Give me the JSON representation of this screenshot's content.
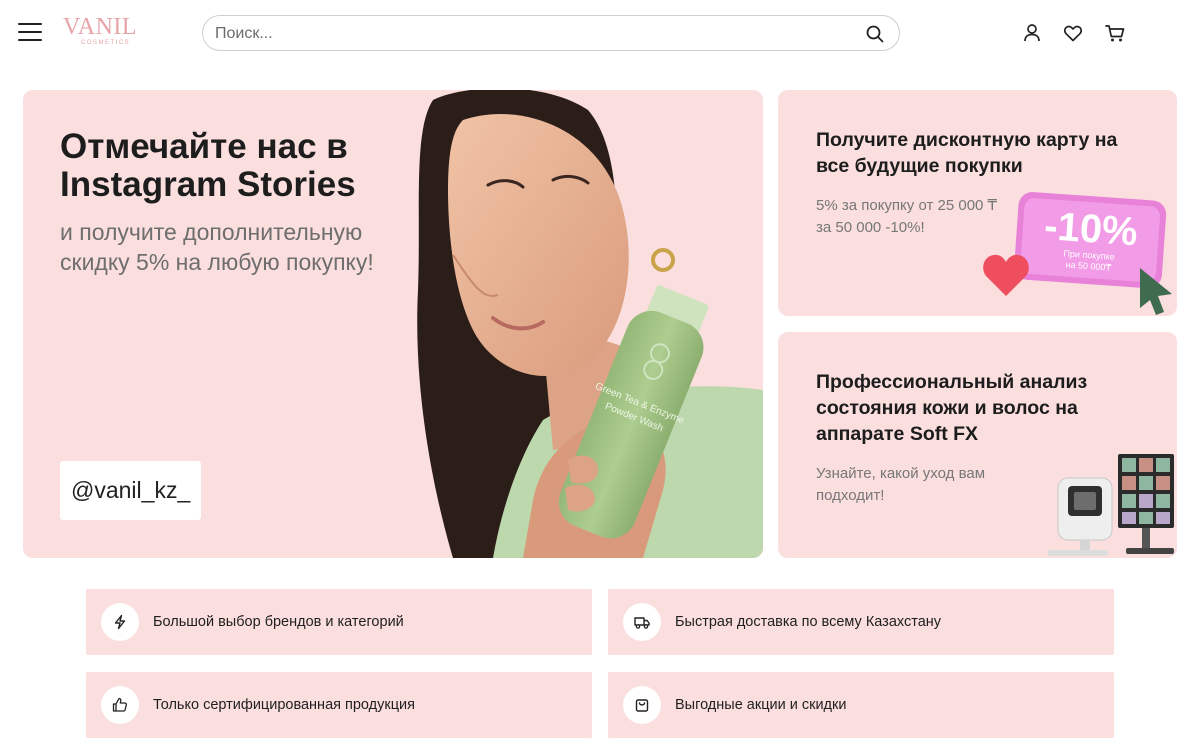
{
  "header": {
    "logo": "VANIL",
    "logo_sub": "COSMETICS",
    "search_placeholder": "Поиск...",
    "icons": [
      "menu-icon",
      "search-icon",
      "user-icon",
      "heart-icon",
      "cart-icon"
    ]
  },
  "hero": {
    "title": "Отмечайте нас в Instagram Stories",
    "subtitle": "и получите дополнительную скидку 5% на любую покупку!",
    "handle": "@vanil_kz_",
    "product_label": "Green Tea & Enzyme Powder Wash"
  },
  "discount_card": {
    "title": "Получите дисконтную карту на все будущие покупки",
    "subtitle": "5% за покупку от 25 000 ₸ за 50 000 -10%!",
    "badge": "-10%",
    "badge_note": "При покупке на 50 000₸"
  },
  "analysis_card": {
    "title": "Профессиональный анализ состояния кожи и волос на аппарате Soft FX",
    "subtitle": "Узнайте, какой уход вам подходит!"
  },
  "features": [
    {
      "label": "Большой выбор брендов и категорий",
      "icon": "lightning-icon"
    },
    {
      "label": "Быстрая доставка по всему Казахстану",
      "icon": "truck-icon"
    },
    {
      "label": "Только сертифицированная продукция",
      "icon": "thumbs-up-icon"
    },
    {
      "label": "Выгодные акции и скидки",
      "icon": "shopping-bag-icon"
    }
  ],
  "colors": {
    "banner_bg": "#fbdede",
    "logo": "#e7a3a8",
    "bottle": "#a9c98a",
    "badge": "#e882d8"
  }
}
